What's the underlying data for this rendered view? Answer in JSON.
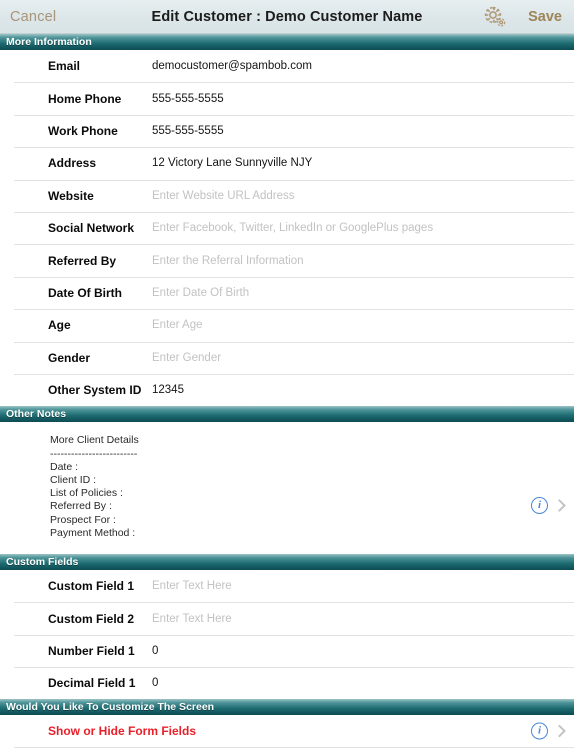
{
  "navbar": {
    "cancel_label": "Cancel",
    "title": "Edit Customer : Demo Customer Name",
    "save_label": "Save",
    "gear_icon": "gear-settings-icon",
    "cancel_color": "#a89478",
    "save_color": "#9d8558",
    "background": "#dde7ea"
  },
  "theme": {
    "section_header_top": "#9dc4c6",
    "section_header_bottom": "#0d4b52",
    "info_blue": "#4a87d6",
    "alert_red": "#e8202a",
    "placeholder_gray": "#c2c2c4",
    "separator": "#e2e2e2"
  },
  "sections": [
    {
      "header": "More Information",
      "rows": [
        {
          "label": "Email",
          "value": "democustomer@spambob.com",
          "is_placeholder": false
        },
        {
          "label": "Home Phone",
          "value": "555-555-5555",
          "is_placeholder": false
        },
        {
          "label": "Work Phone",
          "value": "555-555-5555",
          "is_placeholder": false
        },
        {
          "label": "Address",
          "value": "12 Victory Lane Sunnyville NJY",
          "is_placeholder": false
        },
        {
          "label": "Website",
          "value": "Enter Website URL Address",
          "is_placeholder": true
        },
        {
          "label": "Social Network",
          "value": "Enter Facebook, Twitter, LinkedIn or GooglePlus pages",
          "is_placeholder": true
        },
        {
          "label": "Referred By",
          "value": "Enter the Referral Information",
          "is_placeholder": true
        },
        {
          "label": "Date Of Birth",
          "value": "Enter Date Of Birth",
          "is_placeholder": true
        },
        {
          "label": "Age",
          "value": "Enter Age",
          "is_placeholder": true
        },
        {
          "label": "Gender",
          "value": "Enter Gender",
          "is_placeholder": true
        },
        {
          "label": "Other System ID",
          "value": "12345",
          "is_placeholder": false
        }
      ]
    }
  ],
  "notes_section": {
    "header": "Other Notes",
    "text": "More Client Details\n-------------------------\nDate :\nClient ID :\nList of Policies :\nReferred By :\nProspect For :\nPayment Method :",
    "info_icon": "info-circle-icon",
    "chevron_icon": "chevron-right-icon"
  },
  "custom_fields_section": {
    "header": "Custom Fields",
    "rows": [
      {
        "label": "Custom Field 1",
        "value": "Enter Text Here",
        "is_placeholder": true
      },
      {
        "label": "Custom Field 2",
        "value": "Enter Text Here",
        "is_placeholder": true
      },
      {
        "label": "Number Field 1",
        "value": "0",
        "is_placeholder": false
      },
      {
        "label": "Decimal Field 1",
        "value": "0",
        "is_placeholder": false
      }
    ]
  },
  "customize_section": {
    "header": "Would You Like To Customize The Screen",
    "action_label": "Show or Hide Form Fields",
    "info_icon": "info-circle-icon",
    "chevron_icon": "chevron-right-icon"
  }
}
